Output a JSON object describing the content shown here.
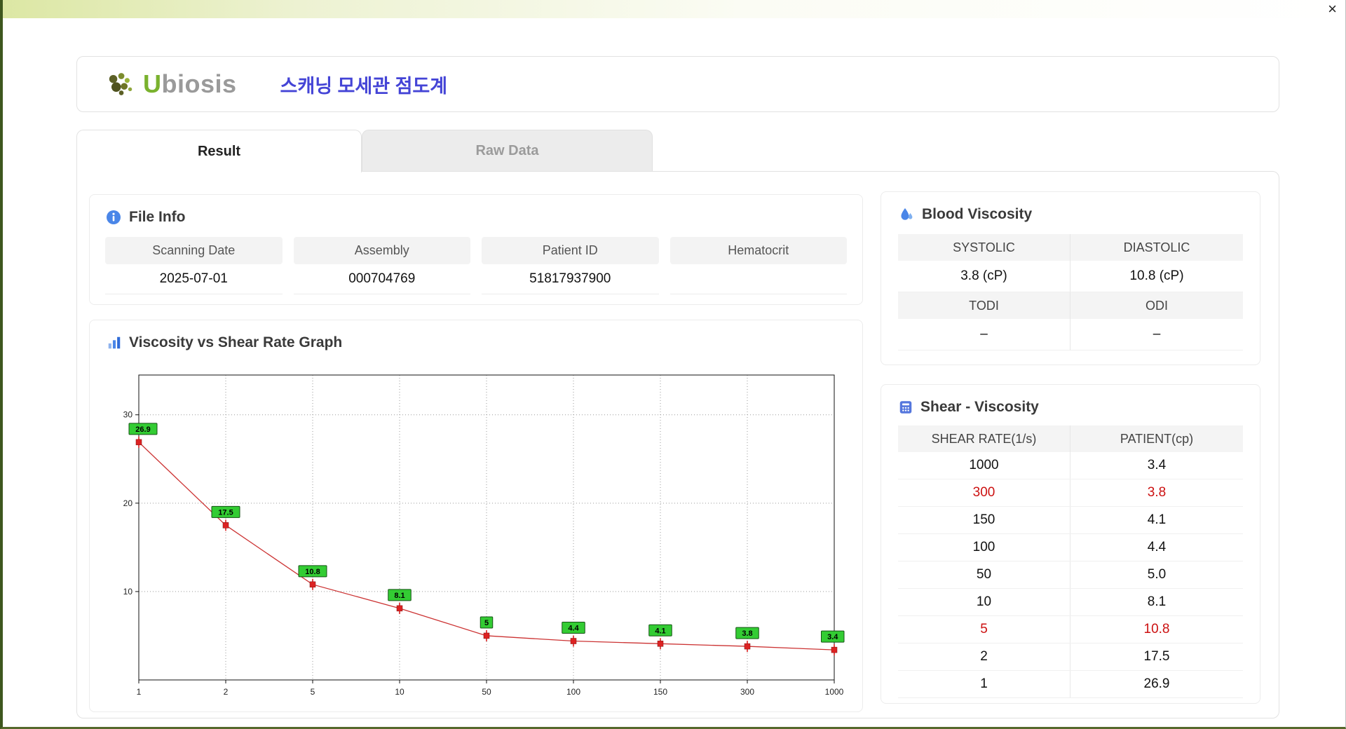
{
  "colors": {
    "accent_blue": "#4a86e8",
    "title_blue": "#4444d6",
    "logo_green": "#7ab22e",
    "logo_gray": "#9a9a9a",
    "line_red": "#cc3333",
    "marker_red": "#dd2222",
    "point_label_green": "#33cc33",
    "highlight_red": "#cc1111",
    "chrome_green": "#dce7a4"
  },
  "window": {
    "close_label": "×"
  },
  "header": {
    "logo_text": "Ubiosis",
    "app_title": "스캐닝 모세관 점도계"
  },
  "tabs": {
    "result_label": "Result",
    "raw_data_label": "Raw Data"
  },
  "file_info": {
    "title": "File Info",
    "fields": [
      {
        "label": "Scanning Date",
        "value": "2025-07-01"
      },
      {
        "label": "Assembly",
        "value": "000704769"
      },
      {
        "label": "Patient ID",
        "value": "51817937900"
      },
      {
        "label": "Hematocrit",
        "value": ""
      }
    ]
  },
  "graph_section": {
    "title": "Viscosity vs Shear Rate Graph"
  },
  "blood_viscosity": {
    "title": "Blood Viscosity",
    "rows": [
      {
        "labels": [
          "SYSTOLIC",
          "DIASTOLIC"
        ],
        "values": [
          "3.8 (cP)",
          "10.8 (cP)"
        ]
      },
      {
        "labels": [
          "TODI",
          "ODI"
        ],
        "values": [
          "–",
          "–"
        ]
      }
    ]
  },
  "shear_viscosity": {
    "title": "Shear - Viscosity",
    "columns": [
      "SHEAR RATE(1/s)",
      "PATIENT(cp)"
    ],
    "rows": [
      {
        "rate": "1000",
        "patient": "3.4",
        "highlight": false
      },
      {
        "rate": "300",
        "patient": "3.8",
        "highlight": true
      },
      {
        "rate": "150",
        "patient": "4.1",
        "highlight": false
      },
      {
        "rate": "100",
        "patient": "4.4",
        "highlight": false
      },
      {
        "rate": "50",
        "patient": "5.0",
        "highlight": false
      },
      {
        "rate": "10",
        "patient": "8.1",
        "highlight": false
      },
      {
        "rate": "5",
        "patient": "10.8",
        "highlight": true
      },
      {
        "rate": "2",
        "patient": "17.5",
        "highlight": false
      },
      {
        "rate": "1",
        "patient": "26.9",
        "highlight": false
      }
    ]
  },
  "chart_data": {
    "type": "line",
    "title": "Viscosity vs Shear Rate Graph",
    "x_axis_type": "category",
    "categories": [
      "1",
      "2",
      "5",
      "10",
      "50",
      "100",
      "150",
      "300",
      "1000"
    ],
    "values": [
      26.9,
      17.5,
      10.8,
      8.1,
      5.0,
      4.4,
      4.1,
      3.8,
      3.4
    ],
    "point_labels": [
      "26.9",
      "17.5",
      "10.8",
      "8.1",
      "5",
      "4.4",
      "4.1",
      "3.8",
      "3.4"
    ],
    "xlabel": "",
    "ylabel": "",
    "ylim": [
      0,
      34.5
    ],
    "yticks": [
      10,
      20,
      30
    ],
    "grid": true,
    "line_color": "#cc3333",
    "marker_color": "#dd2222",
    "point_label_bg": "#33cc33"
  }
}
